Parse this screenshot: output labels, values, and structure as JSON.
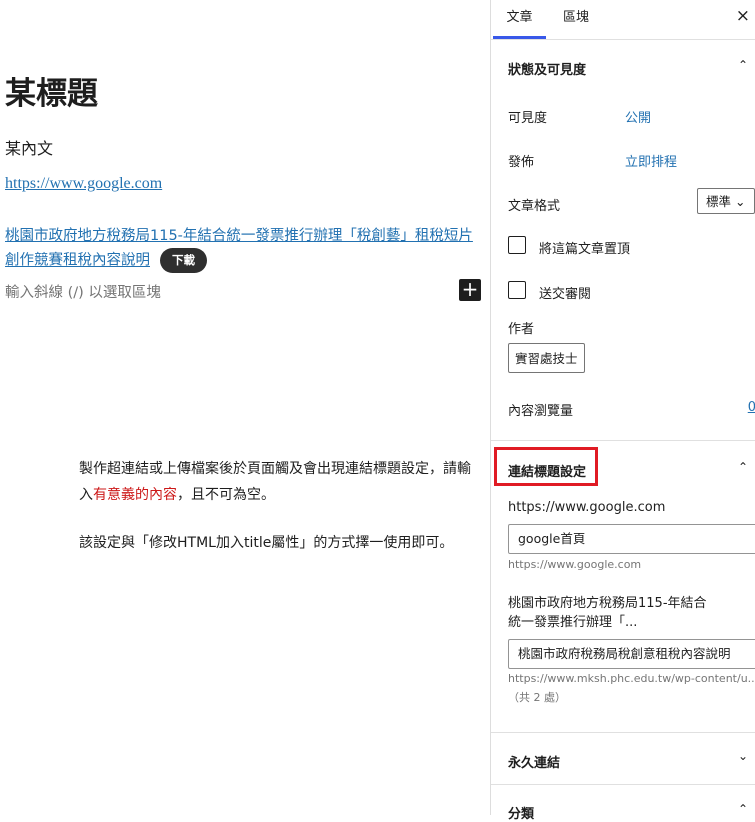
{
  "editor": {
    "title": "某標題",
    "body_text": "某內文",
    "link1": "https://www.google.com",
    "link2": "桃園市政府地方稅務局115-年結合統一發票推行辦理「稅創藝」租稅短片創作競賽租稅內容說明",
    "download_label": "下載",
    "placeholder": "輸入斜線 (/) 以選取區塊",
    "inserter_icon": "+",
    "note": {
      "p1_before": "製作超連結或上傳檔案後於頁面觸及會出現連結標題設定，請輸入",
      "p1_highlight": "有意義的內容",
      "p1_after": "，且不可為空。",
      "p2": "該設定與「修改HTML加入title屬性」的方式擇一使用即可。"
    }
  },
  "sidebar": {
    "tabs": [
      "文章",
      "區塊"
    ],
    "close_icon": "×",
    "status_panel": {
      "title": "狀態及可見度",
      "visibility_label": "可見度",
      "visibility_value": "公開",
      "publish_label": "發佈",
      "publish_value": "立即排程",
      "format_label": "文章格式",
      "format_value": "標準",
      "sticky_label": "將這篇文章置頂",
      "review_label": "送交審閱",
      "author_label": "作者",
      "author_value": "實習處技士",
      "views_label": "內容瀏覽量",
      "views_value": "0"
    },
    "link_title_panel": {
      "title": "連結標題設定",
      "item1_url": "https://www.google.com",
      "item1_value": "google首頁",
      "item1_help": "https://www.google.com",
      "item2_name": "桃園市政府地方稅務局115-年結合統一發票推行辦理「...",
      "item2_value": "桃園市政府稅務局稅創意租稅內容說明",
      "item2_help": "https://www.mksh.phc.edu.tw/wp-content/u...",
      "item2_count": "（共 2 處）",
      "highlight_color": "#e01b24"
    },
    "permalink_panel": {
      "title": "永久連結"
    },
    "category_panel": {
      "title": "分類"
    }
  },
  "colors": {
    "accent": "#3858e9",
    "link": "#2271b1",
    "danger": "#cc1818"
  }
}
